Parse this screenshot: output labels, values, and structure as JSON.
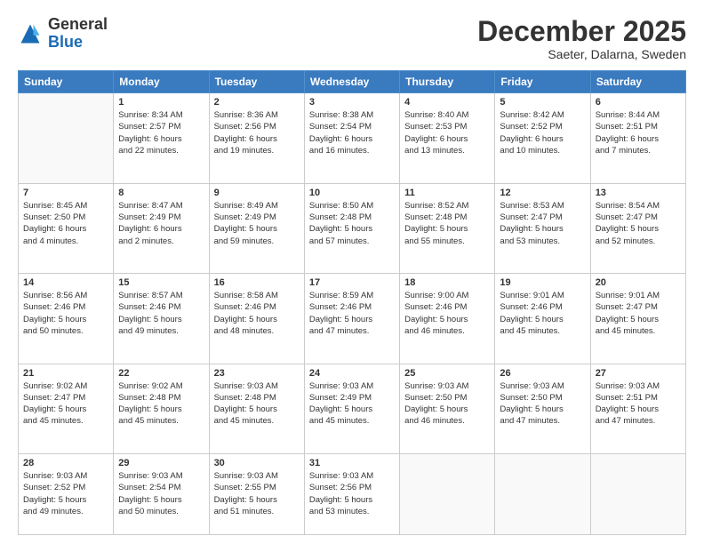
{
  "header": {
    "logo_general": "General",
    "logo_blue": "Blue",
    "month_title": "December 2025",
    "location": "Saeter, Dalarna, Sweden"
  },
  "weekdays": [
    "Sunday",
    "Monday",
    "Tuesday",
    "Wednesday",
    "Thursday",
    "Friday",
    "Saturday"
  ],
  "weeks": [
    [
      {
        "day": "",
        "info": ""
      },
      {
        "day": "1",
        "info": "Sunrise: 8:34 AM\nSunset: 2:57 PM\nDaylight: 6 hours\nand 22 minutes."
      },
      {
        "day": "2",
        "info": "Sunrise: 8:36 AM\nSunset: 2:56 PM\nDaylight: 6 hours\nand 19 minutes."
      },
      {
        "day": "3",
        "info": "Sunrise: 8:38 AM\nSunset: 2:54 PM\nDaylight: 6 hours\nand 16 minutes."
      },
      {
        "day": "4",
        "info": "Sunrise: 8:40 AM\nSunset: 2:53 PM\nDaylight: 6 hours\nand 13 minutes."
      },
      {
        "day": "5",
        "info": "Sunrise: 8:42 AM\nSunset: 2:52 PM\nDaylight: 6 hours\nand 10 minutes."
      },
      {
        "day": "6",
        "info": "Sunrise: 8:44 AM\nSunset: 2:51 PM\nDaylight: 6 hours\nand 7 minutes."
      }
    ],
    [
      {
        "day": "7",
        "info": "Sunrise: 8:45 AM\nSunset: 2:50 PM\nDaylight: 6 hours\nand 4 minutes."
      },
      {
        "day": "8",
        "info": "Sunrise: 8:47 AM\nSunset: 2:49 PM\nDaylight: 6 hours\nand 2 minutes."
      },
      {
        "day": "9",
        "info": "Sunrise: 8:49 AM\nSunset: 2:49 PM\nDaylight: 5 hours\nand 59 minutes."
      },
      {
        "day": "10",
        "info": "Sunrise: 8:50 AM\nSunset: 2:48 PM\nDaylight: 5 hours\nand 57 minutes."
      },
      {
        "day": "11",
        "info": "Sunrise: 8:52 AM\nSunset: 2:48 PM\nDaylight: 5 hours\nand 55 minutes."
      },
      {
        "day": "12",
        "info": "Sunrise: 8:53 AM\nSunset: 2:47 PM\nDaylight: 5 hours\nand 53 minutes."
      },
      {
        "day": "13",
        "info": "Sunrise: 8:54 AM\nSunset: 2:47 PM\nDaylight: 5 hours\nand 52 minutes."
      }
    ],
    [
      {
        "day": "14",
        "info": "Sunrise: 8:56 AM\nSunset: 2:46 PM\nDaylight: 5 hours\nand 50 minutes."
      },
      {
        "day": "15",
        "info": "Sunrise: 8:57 AM\nSunset: 2:46 PM\nDaylight: 5 hours\nand 49 minutes."
      },
      {
        "day": "16",
        "info": "Sunrise: 8:58 AM\nSunset: 2:46 PM\nDaylight: 5 hours\nand 48 minutes."
      },
      {
        "day": "17",
        "info": "Sunrise: 8:59 AM\nSunset: 2:46 PM\nDaylight: 5 hours\nand 47 minutes."
      },
      {
        "day": "18",
        "info": "Sunrise: 9:00 AM\nSunset: 2:46 PM\nDaylight: 5 hours\nand 46 minutes."
      },
      {
        "day": "19",
        "info": "Sunrise: 9:01 AM\nSunset: 2:46 PM\nDaylight: 5 hours\nand 45 minutes."
      },
      {
        "day": "20",
        "info": "Sunrise: 9:01 AM\nSunset: 2:47 PM\nDaylight: 5 hours\nand 45 minutes."
      }
    ],
    [
      {
        "day": "21",
        "info": "Sunrise: 9:02 AM\nSunset: 2:47 PM\nDaylight: 5 hours\nand 45 minutes."
      },
      {
        "day": "22",
        "info": "Sunrise: 9:02 AM\nSunset: 2:48 PM\nDaylight: 5 hours\nand 45 minutes."
      },
      {
        "day": "23",
        "info": "Sunrise: 9:03 AM\nSunset: 2:48 PM\nDaylight: 5 hours\nand 45 minutes."
      },
      {
        "day": "24",
        "info": "Sunrise: 9:03 AM\nSunset: 2:49 PM\nDaylight: 5 hours\nand 45 minutes."
      },
      {
        "day": "25",
        "info": "Sunrise: 9:03 AM\nSunset: 2:50 PM\nDaylight: 5 hours\nand 46 minutes."
      },
      {
        "day": "26",
        "info": "Sunrise: 9:03 AM\nSunset: 2:50 PM\nDaylight: 5 hours\nand 47 minutes."
      },
      {
        "day": "27",
        "info": "Sunrise: 9:03 AM\nSunset: 2:51 PM\nDaylight: 5 hours\nand 47 minutes."
      }
    ],
    [
      {
        "day": "28",
        "info": "Sunrise: 9:03 AM\nSunset: 2:52 PM\nDaylight: 5 hours\nand 49 minutes."
      },
      {
        "day": "29",
        "info": "Sunrise: 9:03 AM\nSunset: 2:54 PM\nDaylight: 5 hours\nand 50 minutes."
      },
      {
        "day": "30",
        "info": "Sunrise: 9:03 AM\nSunset: 2:55 PM\nDaylight: 5 hours\nand 51 minutes."
      },
      {
        "day": "31",
        "info": "Sunrise: 9:03 AM\nSunset: 2:56 PM\nDaylight: 5 hours\nand 53 minutes."
      },
      {
        "day": "",
        "info": ""
      },
      {
        "day": "",
        "info": ""
      },
      {
        "day": "",
        "info": ""
      }
    ]
  ]
}
